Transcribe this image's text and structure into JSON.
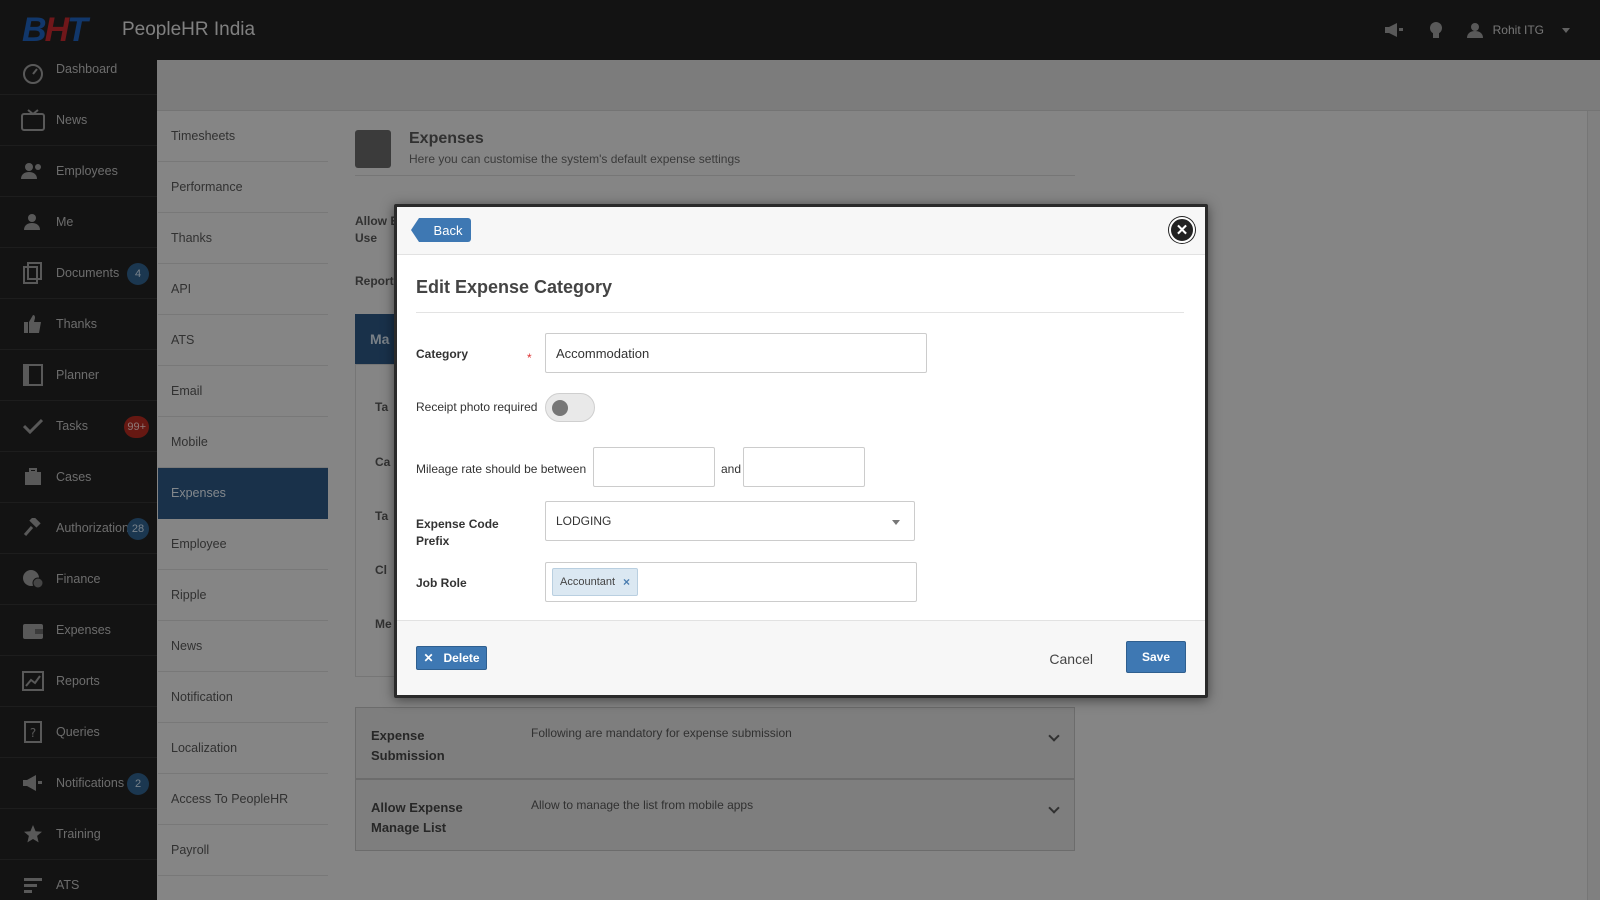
{
  "app": {
    "title": "PeopleHR India",
    "logo_text": "BHT"
  },
  "topbar": {
    "user_name": "Rohit ITG",
    "icons": [
      "megaphone-icon",
      "lightbulb-icon",
      "user-icon"
    ]
  },
  "sidebar": {
    "items": [
      {
        "label": "Dashboard",
        "icon": "dashboard-icon"
      },
      {
        "label": "News",
        "icon": "tv-icon"
      },
      {
        "label": "Employees",
        "icon": "users-icon"
      },
      {
        "label": "Me",
        "icon": "person-icon"
      },
      {
        "label": "Documents",
        "icon": "documents-icon",
        "badge": "4"
      },
      {
        "label": "Thanks",
        "icon": "thumbs-up-icon"
      },
      {
        "label": "Planner",
        "icon": "planner-icon"
      },
      {
        "label": "Tasks",
        "icon": "check-icon",
        "badge": "99+"
      },
      {
        "label": "Cases",
        "icon": "briefcase-icon"
      },
      {
        "label": "Authorizations",
        "icon": "gavel-icon",
        "badge": "28"
      },
      {
        "label": "Finance",
        "icon": "coins-icon"
      },
      {
        "label": "Expenses",
        "icon": "wallet-icon"
      },
      {
        "label": "Reports",
        "icon": "chart-icon"
      },
      {
        "label": "Queries",
        "icon": "question-icon"
      },
      {
        "label": "Notifications",
        "icon": "megaphone-icon",
        "badge": "2"
      },
      {
        "label": "Training",
        "icon": "star-icon"
      },
      {
        "label": "ATS",
        "icon": "list-icon"
      }
    ]
  },
  "subnav": {
    "items": [
      "Timesheets",
      "Performance",
      "Thanks",
      "API",
      "ATS",
      "Email",
      "Mobile",
      "Expenses",
      "Employee",
      "Ripple",
      "News",
      "Notification",
      "Localization",
      "Access To PeopleHR",
      "Payroll"
    ],
    "active": "Expenses"
  },
  "page": {
    "title": "Expenses",
    "subtitle": "Here you can customise the system's default expense settings",
    "bg_labels": [
      "Allow E",
      "Use",
      "Report",
      "Ma",
      "Ta",
      "Ca",
      "Ta",
      "Cl",
      "Me"
    ],
    "accordions": [
      {
        "title": "Expense Submission",
        "desc": "Following are mandatory for expense submission"
      },
      {
        "title": "Allow Expense Manage List",
        "desc": "Allow to manage the list from mobile apps"
      }
    ]
  },
  "modal": {
    "back_label": "Back",
    "close_symbol": "✕",
    "title": "Edit Expense Category",
    "category_label": "Category",
    "required_mark": "*",
    "category_value": "Accommodation",
    "receipt_label": "Receipt photo required",
    "receipt_on": false,
    "mileage_label": "Mileage rate should be between",
    "mileage_min": "",
    "mileage_and": "and",
    "mileage_max": "",
    "prefix_label": "Expense Code Prefix",
    "prefix_value": "LODGING",
    "job_role_label": "Job Role",
    "job_role_tag": "Accountant",
    "tag_remove": "×",
    "delete_label": "Delete",
    "delete_icon": "✕",
    "cancel_label": "Cancel",
    "save_label": "Save"
  },
  "colors": {
    "accent": "#3e78b3",
    "sidebar_bg": "#222222",
    "active_subnav": "#2b5580",
    "badge_red": "#b02a20"
  }
}
